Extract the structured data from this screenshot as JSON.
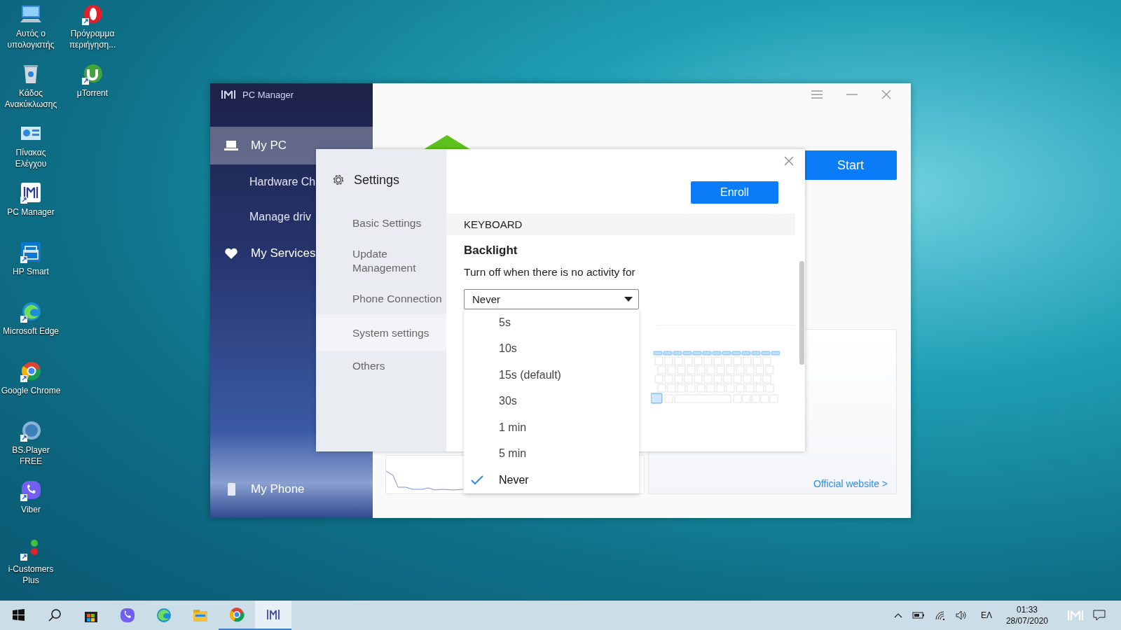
{
  "desktop_icons": [
    {
      "label": "Αυτός ο υπολογιστής"
    },
    {
      "label": "Πρόγραμμα περιήγηση..."
    },
    {
      "label": "Κάδος Ανακύκλωσης"
    },
    {
      "label": "μTorrent"
    },
    {
      "label": "Πίνακας Ελέγχου"
    },
    {
      "label": "PC Manager"
    },
    {
      "label": "HP Smart"
    },
    {
      "label": "Microsoft Edge"
    },
    {
      "label": "Google Chrome"
    },
    {
      "label": "BS.Player FREE"
    },
    {
      "label": "Viber"
    },
    {
      "label": "i-Customers Plus"
    }
  ],
  "main_window": {
    "title": "PC Manager",
    "nav": [
      {
        "label": "My PC",
        "kind": "section",
        "selected": true
      },
      {
        "label": "Hardware Ch",
        "kind": "sub",
        "selected": false
      },
      {
        "label": "Manage driv",
        "kind": "sub",
        "selected": false
      },
      {
        "label": "My Services",
        "kind": "section",
        "selected": false
      },
      {
        "label": "My Phone",
        "kind": "bottom",
        "selected": false
      }
    ],
    "start_button": "Start",
    "website_link": "Official website >"
  },
  "settings": {
    "title": "Settings",
    "nav": [
      {
        "label": "Basic Settings",
        "selected": false
      },
      {
        "label": "Update Management",
        "selected": false
      },
      {
        "label": "Phone Connection",
        "selected": false
      },
      {
        "label": "System settings",
        "selected": true
      },
      {
        "label": "Others",
        "selected": false
      }
    ],
    "enroll_button": "Enroll",
    "section_header": "KEYBOARD",
    "setting_title": "Backlight",
    "description": "Turn off when there is no activity for",
    "dropdown": {
      "value": "Never",
      "expanded": true,
      "options": [
        {
          "label": "5s",
          "selected": false
        },
        {
          "label": "10s",
          "selected": false
        },
        {
          "label": "15s (default)",
          "selected": false
        },
        {
          "label": "30s",
          "selected": false
        },
        {
          "label": "1 min",
          "selected": false
        },
        {
          "label": "5 min",
          "selected": false
        },
        {
          "label": "Never",
          "selected": true
        }
      ]
    }
  },
  "taskbar": {
    "apps": [
      {
        "running": false,
        "selected": false
      },
      {
        "running": false,
        "selected": false
      },
      {
        "running": false,
        "selected": false
      },
      {
        "running": false,
        "selected": false
      },
      {
        "running": false,
        "selected": false
      },
      {
        "running": true,
        "selected": false
      },
      {
        "running": true,
        "selected": true
      }
    ],
    "language": "ΕΛ",
    "time": "01:33",
    "date": "28/07/2020"
  }
}
